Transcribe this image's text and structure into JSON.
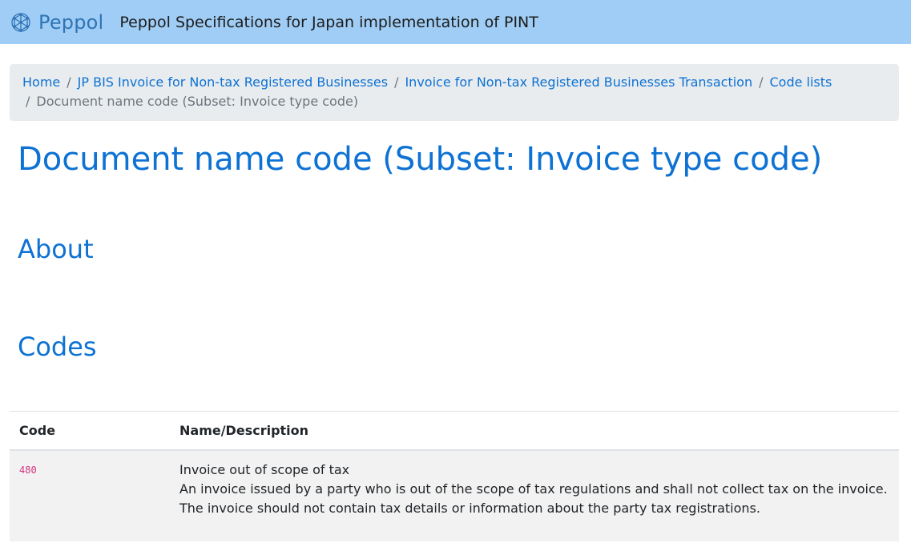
{
  "header": {
    "brand_name": "Peppol",
    "site_title": "Peppol Specifications for Japan implementation of PINT",
    "brand_color": "#2f74b5",
    "bar_color": "#a0cdf5",
    "logo_icon": "peppol-network-logo-icon"
  },
  "breadcrumb": {
    "items": [
      {
        "label": "Home"
      },
      {
        "label": "JP BIS Invoice for Non-tax Registered Businesses"
      },
      {
        "label": "Invoice for Non-tax Registered Businesses Transaction"
      },
      {
        "label": "Code lists"
      }
    ],
    "separator": "/",
    "current": "Document name code (Subset: Invoice type code)"
  },
  "page": {
    "title": "Document name code (Subset: Invoice type code)",
    "sections": {
      "about": "About",
      "codes": "Codes"
    },
    "accent_color": "#0d72d3"
  },
  "table": {
    "headers": {
      "code": "Code",
      "name_description": "Name/Description"
    },
    "rows": [
      {
        "code": "480",
        "name": "Invoice out of scope of tax",
        "description_line1": "An invoice issued by a party who is out of the scope of tax regulations and shall not collect tax on the invoice.",
        "description_line2": "The invoice should not contain tax details or information about the party tax registrations."
      }
    ]
  }
}
